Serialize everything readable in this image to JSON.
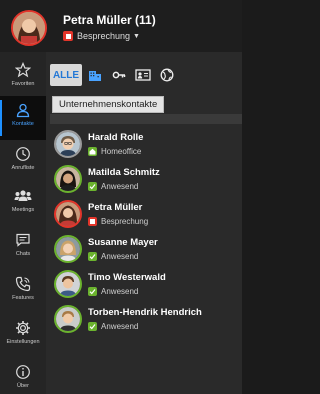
{
  "header": {
    "title": "Petra Müller (11)",
    "status_label": "Besprechung",
    "status_color": "#e3352a"
  },
  "sidebar": {
    "items": [
      {
        "label": "Favoriten",
        "icon": "star-icon"
      },
      {
        "label": "Kontakte",
        "icon": "person-icon",
        "active": true
      },
      {
        "label": "Anrufliste",
        "icon": "clock-icon"
      },
      {
        "label": "Meetings",
        "icon": "people-icon"
      },
      {
        "label": "Chats",
        "icon": "chat-icon"
      },
      {
        "label": "Features",
        "icon": "phone-icon"
      },
      {
        "label": "Einstellungen",
        "icon": "gear-icon"
      },
      {
        "label": "Über",
        "icon": "info-icon"
      }
    ]
  },
  "tabs": {
    "alle_label": "ALLE",
    "icons": [
      "building-icon",
      "key-icon",
      "contact-card-icon",
      "globe-icon"
    ]
  },
  "tooltip": "Unternehmenskontakte",
  "contacts": [
    {
      "name": "Harald Rolle",
      "status": "Homeoffice",
      "status_color": "#9a9a9a"
    },
    {
      "name": "Matilda Schmitz",
      "status": "Anwesend",
      "status_color": "#6bb32e"
    },
    {
      "name": "Petra Müller",
      "status": "Besprechung",
      "status_color": "#e3352a"
    },
    {
      "name": "Susanne Mayer",
      "status": "Anwesend",
      "status_color": "#6bb32e"
    },
    {
      "name": "Timo Westerwald",
      "status": "Anwesend",
      "status_color": "#6bb32e"
    },
    {
      "name": "Torben-Hendrik Hendrich",
      "status": "Anwesend",
      "status_color": "#6bb32e"
    }
  ],
  "colors": {
    "accent": "#1e90ff",
    "present": "#6bb32e",
    "busy": "#e3352a",
    "away": "#9a9a9a"
  }
}
